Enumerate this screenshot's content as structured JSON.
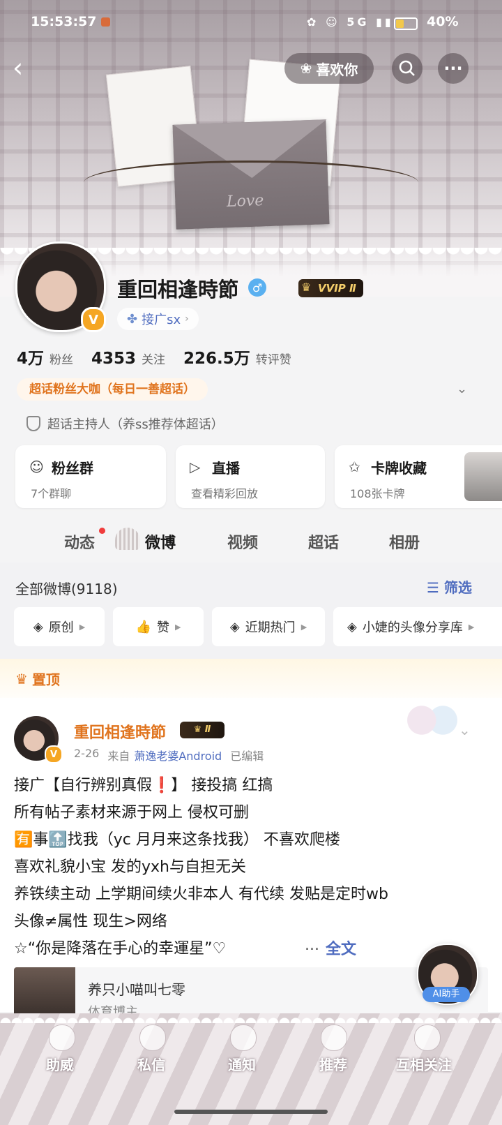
{
  "status_bar": {
    "time": "15:53:57",
    "network": "5G",
    "battery": "40%"
  },
  "nav": {
    "like_label": "喜欢你",
    "back_icon": "chevron-left-icon",
    "search_icon": "search-icon",
    "more_icon": "more-icon"
  },
  "banner": {
    "decor_text": "Love"
  },
  "profile": {
    "username": "重回相逢時節",
    "vip_badge": "VVIP Ⅱ",
    "tag": "接广sx",
    "stats": {
      "followers_value": "4万",
      "followers_label": "粉丝",
      "following_value": "4353",
      "following_label": "关注",
      "likes_value": "226.5万",
      "likes_label": "转评赞"
    },
    "super_title": "超话粉丝大咖（每日一善超话）",
    "host_text": "超话主持人（养ss推荐体超话）"
  },
  "cards": [
    {
      "title": "粉丝群",
      "sub": "7个群聊"
    },
    {
      "title": "直播",
      "sub": "查看精彩回放"
    },
    {
      "title": "卡牌收藏",
      "sub": "108张卡牌"
    }
  ],
  "tabs": [
    "动态",
    "微博",
    "视频",
    "超话",
    "相册"
  ],
  "feed": {
    "all_label": "全部微博(9118)",
    "filter_label": "筛选",
    "chips": [
      "原创",
      "赞",
      "近期热门",
      "小婕的头像分享库"
    ]
  },
  "pinned": {
    "label": "置顶"
  },
  "post": {
    "author": "重回相逢時節",
    "badge": "Ⅱ",
    "date": "2-26",
    "from_label": "来自",
    "source": "萧逸老婆Android",
    "edited": "已编辑",
    "body": "接广【自行辨别真假❗️】 接投搞 红搞\n所有帖子素材来源于网上 侵权可删\n🈶事🔝找我（yc 月月来这条找我） 不喜欢爬楼\n 喜欢礼貌小宝 发的yxh与自担无关\n养铁续主动 上学期间续火非本人 有代续 发贴是定时wb\n头像≠属性 现生>网络\n☆“你是降落在手心的幸運星”♡",
    "ellipsis": "...",
    "full_text": "全文"
  },
  "retweet": {
    "title": "养只小喵叫七零",
    "sub": "体育博主"
  },
  "ai_label": "AI助手",
  "bottom_nav": [
    "助威",
    "私信",
    "通知",
    "推荐",
    "互相关注"
  ]
}
